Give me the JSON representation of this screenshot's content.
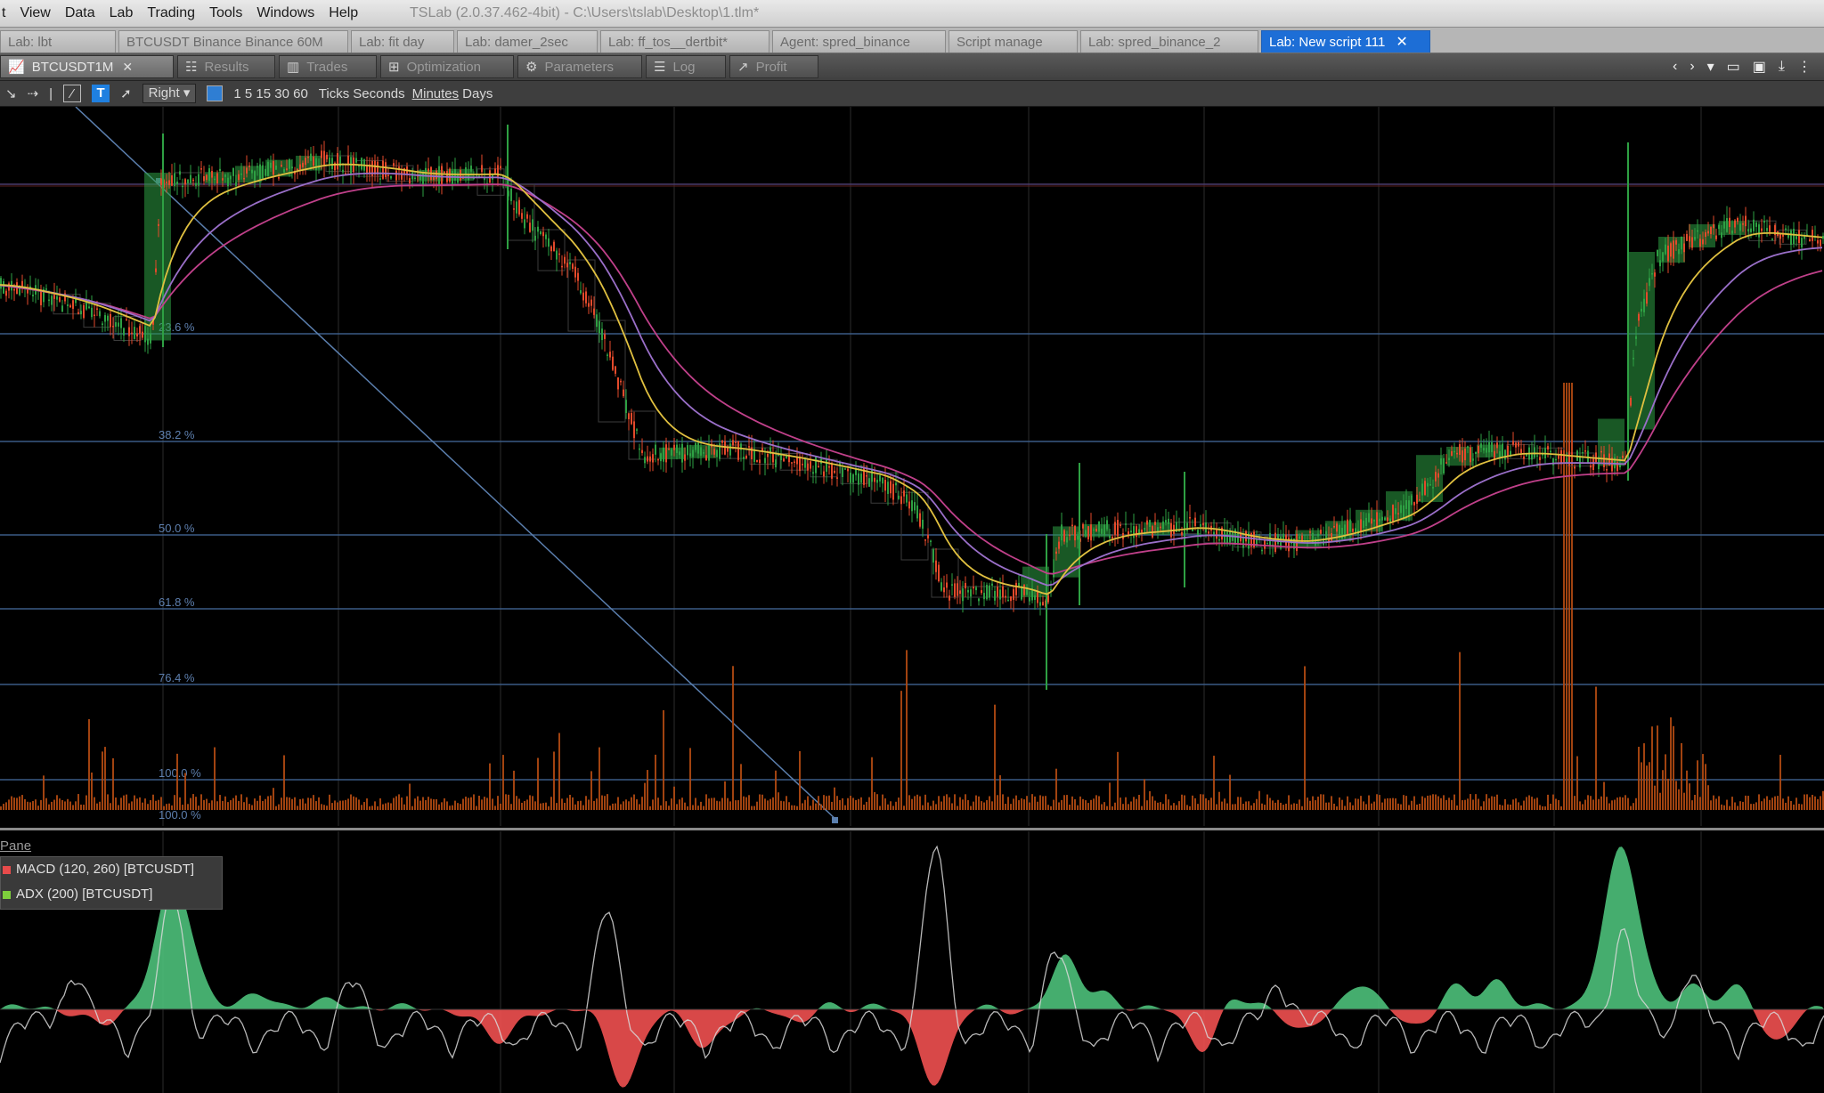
{
  "menu": {
    "items": [
      "View",
      "Data",
      "Lab",
      "Trading",
      "Tools",
      "Windows",
      "Help"
    ],
    "window_title": "TSLab (2.0.37.462-4bit) - C:\\Users\\tslab\\Desktop\\1.tlm*"
  },
  "doc_tabs": [
    {
      "label": "Lab: lbt",
      "active": false
    },
    {
      "label": "BTCUSDT Binance Binance 60M",
      "active": false
    },
    {
      "label": "Lab: fit day",
      "active": false
    },
    {
      "label": "Lab: damer_2sec",
      "active": false
    },
    {
      "label": "Lab: ff_tos__dertbit*",
      "active": false
    },
    {
      "label": "Agent: spred_binance",
      "active": false
    },
    {
      "label": "Script manage",
      "active": false
    },
    {
      "label": "Lab: spred_binance_2",
      "active": false
    },
    {
      "label": "Lab: New script 111",
      "active": true
    }
  ],
  "view_tabs": [
    {
      "label": "BTCUSDT1M",
      "icon": "chart-icon",
      "active": true
    },
    {
      "label": "Results",
      "icon": "results-icon",
      "active": false
    },
    {
      "label": "Trades",
      "icon": "trades-icon",
      "active": false
    },
    {
      "label": "Optimization",
      "icon": "optimization-icon",
      "active": false
    },
    {
      "label": "Parameters",
      "icon": "parameters-icon",
      "active": false
    },
    {
      "label": "Log",
      "icon": "log-icon",
      "active": false
    },
    {
      "label": "Profit",
      "icon": "profit-icon",
      "active": false
    }
  ],
  "toolbar": {
    "text_tool": "T",
    "align_select": "Right",
    "intervals": "1 5 15 30 60",
    "timeframes": {
      "ticks": "Ticks",
      "seconds": "Seconds",
      "minutes": "Minutes",
      "days": "Days"
    },
    "swatch_color": "#2f7ed3"
  },
  "chart": {
    "fib_labels": [
      "23.6 %",
      "38.2 %",
      "50.0 %",
      "61.8 %",
      "76.4 %",
      "100.0 %"
    ],
    "colors": {
      "bull": "#2ea043",
      "bear": "#e34a2b",
      "ma_fast": "#e0c040",
      "ma_mid": "#9a6fc9",
      "ma_slow": "#c0408a",
      "volume": "#b34a12",
      "fib": "#3a5b86",
      "grid": "#1f1f1f",
      "trend": "#5b7fae"
    }
  },
  "indicators": {
    "pane_title": "Pane",
    "series": [
      {
        "name": "MACD (120, 260) [BTCUSDT]",
        "color": "#e84b4b"
      },
      {
        "name": "ADX (200) [BTCUSDT]",
        "color": "#7dcf3c"
      }
    ],
    "colors": {
      "pos": "#4cc07a",
      "neg": "#f05050",
      "line": "#d8d8d8"
    }
  }
}
